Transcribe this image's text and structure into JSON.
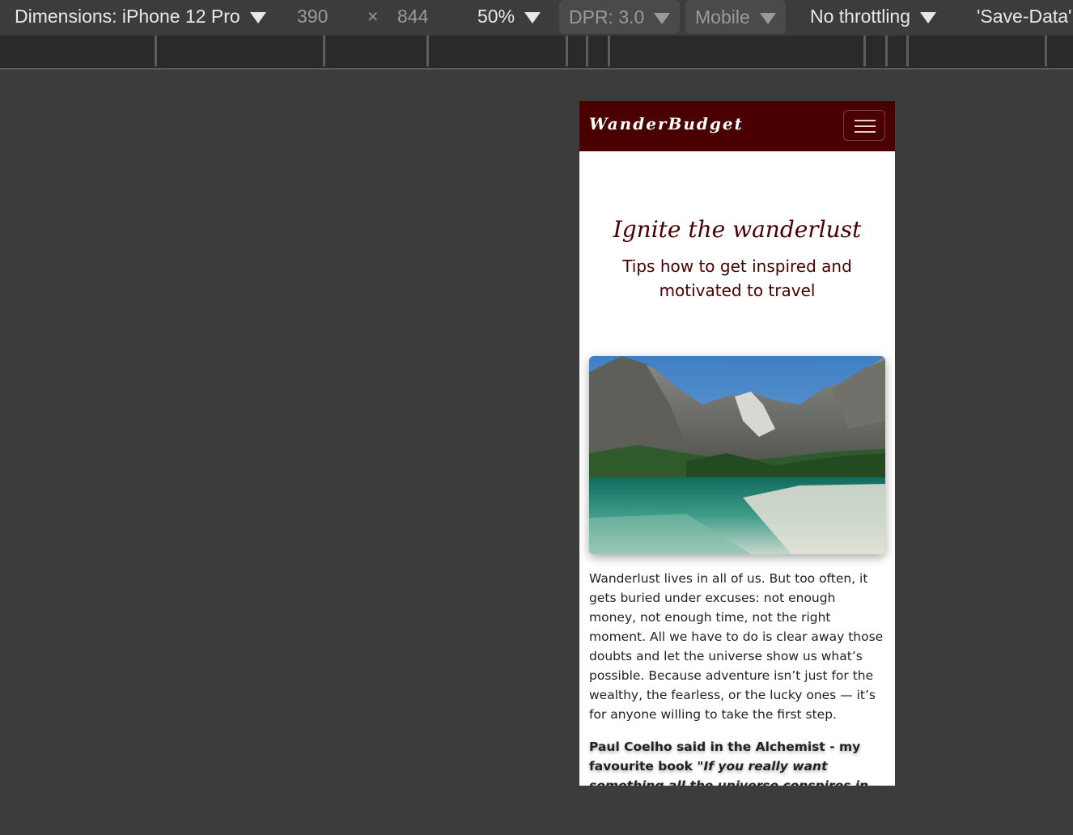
{
  "devtools": {
    "dimensions_label": "Dimensions: iPhone 12 Pro",
    "width": "390",
    "times": "×",
    "height": "844",
    "zoom": "50%",
    "dpr": "DPR: 3.0",
    "mode": "Mobile",
    "throttling": "No throttling",
    "save_data": "'Save-Data'"
  },
  "navbar": {
    "brand": "WanderBudget",
    "bg_color": "#4a0000"
  },
  "hero": {
    "title": "Ignite the wanderlust",
    "subtitle": "Tips how to get inspired and motivated to travel"
  },
  "article": {
    "paragraph": "Wanderlust lives in all of us. But too often, it gets buried under excuses: not enough money, not enough time, not the right moment. All we have to do is clear away those doubts and let the universe show us what’s possible. Because adventure isn’t just for the wealthy, the fearless, or the lucky ones — it’s for anyone willing to take the first step.",
    "quote_intro": "Paul Coelho said in the Alchemist - my favourite book ",
    "quote_text": "\"If you really want something all the universe conspires in helping you to achieve it.\""
  }
}
